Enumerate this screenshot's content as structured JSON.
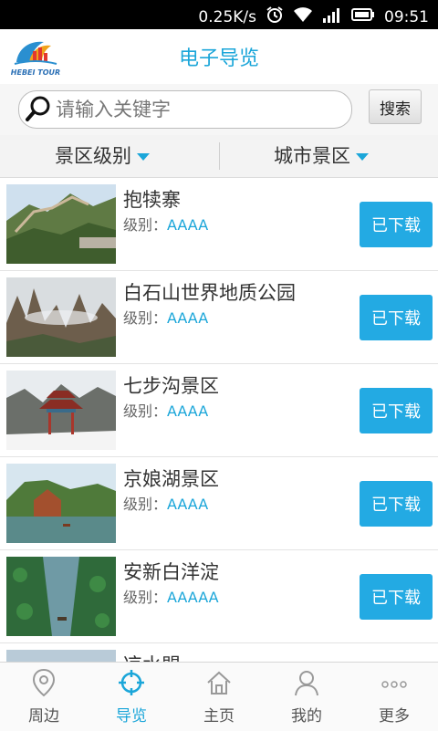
{
  "status_bar": {
    "speed": "0.25K/s",
    "time": "09:51"
  },
  "header": {
    "logo_text": "HEBEI TOUR",
    "title": "电子导览"
  },
  "search": {
    "placeholder": "请输入关键字",
    "button_label": "搜索"
  },
  "filters": [
    {
      "label": "景区级别"
    },
    {
      "label": "城市景区"
    }
  ],
  "scenic_spots": [
    {
      "name": "抱犊寨",
      "level_label": "级别：",
      "level": "AAAA",
      "button_label": "已下载"
    },
    {
      "name": "白石山世界地质公园",
      "level_label": "级别：",
      "level": "AAAA",
      "button_label": "已下载"
    },
    {
      "name": "七步沟景区",
      "level_label": "级别：",
      "level": "AAAA",
      "button_label": "已下载"
    },
    {
      "name": "京娘湖景区",
      "level_label": "级别：",
      "level": "AAAA",
      "button_label": "已下载"
    },
    {
      "name": "安新白洋淀",
      "level_label": "级别：",
      "level": "AAAAA",
      "button_label": "已下载"
    },
    {
      "name": "凉水盟",
      "level_label": "",
      "level": "",
      "button_label": ""
    }
  ],
  "tabs": [
    {
      "label": "周边",
      "icon": "location-pin-icon"
    },
    {
      "label": "导览",
      "icon": "target-icon",
      "active": true
    },
    {
      "label": "主页",
      "icon": "home-icon"
    },
    {
      "label": "我的",
      "icon": "user-icon"
    },
    {
      "label": "更多",
      "icon": "more-dots-icon"
    }
  ],
  "colors": {
    "accent": "#1ba6d9",
    "button": "#23aae3"
  }
}
